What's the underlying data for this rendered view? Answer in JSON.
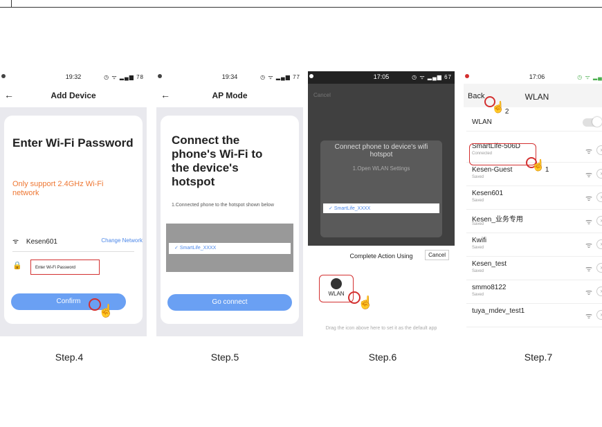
{
  "steps": [
    "Step.4",
    "Step.5",
    "Step.6",
    "Step.7"
  ],
  "phone1": {
    "time": "19:32",
    "battery": "78",
    "title": "Add Device",
    "heading": "Enter Wi-Fi Password",
    "note": "Only support 2.4GHz Wi-Fi network",
    "ssid": "Kesen601",
    "change": "Change Network",
    "pwd_placeholder": "Enter Wi-Fi Password",
    "confirm": "Confirm"
  },
  "phone2": {
    "time": "19:34",
    "battery": "77",
    "title": "AP Mode",
    "heading": "Connect the phone's Wi-Fi to the device's hotspot",
    "instruction": "1.Connected phone to the hotspot shown below",
    "hotspot": "SmartLife_XXXX",
    "button": "Go connect"
  },
  "phone3": {
    "time": "17:05",
    "battery": "67",
    "cancel_top": "Cancel",
    "modal_title": "Connect phone to device's wifi hotspot",
    "modal_step": "1.Open WLAN Settings",
    "hotspot": "SmartLife_XXXX",
    "sheet_title": "Complete Action Using",
    "sheet_cancel": "Cancel",
    "app": "WLAN",
    "sheet_footer": "Drag the icon above here to set it as the default app"
  },
  "phone4": {
    "time": "17:06",
    "back": "Back",
    "title": "WLAN",
    "toggle_label": "WLAN",
    "networks": [
      {
        "name": "SmartLife-506D",
        "status": "Connected"
      },
      {
        "name": "Kesen-Guest",
        "status": "Saved"
      },
      {
        "name": "Kesen601",
        "status": "Saved"
      },
      {
        "name": "Kesen_业务专用",
        "status": "Saved"
      },
      {
        "name": "Kwifi",
        "status": "Saved"
      },
      {
        "name": "Kesen_test",
        "status": "Saved"
      },
      {
        "name": "smmo8122",
        "status": "Saved"
      },
      {
        "name": "tuya_mdev_test1",
        "status": ""
      }
    ],
    "callout1": "1",
    "callout2": "2"
  }
}
